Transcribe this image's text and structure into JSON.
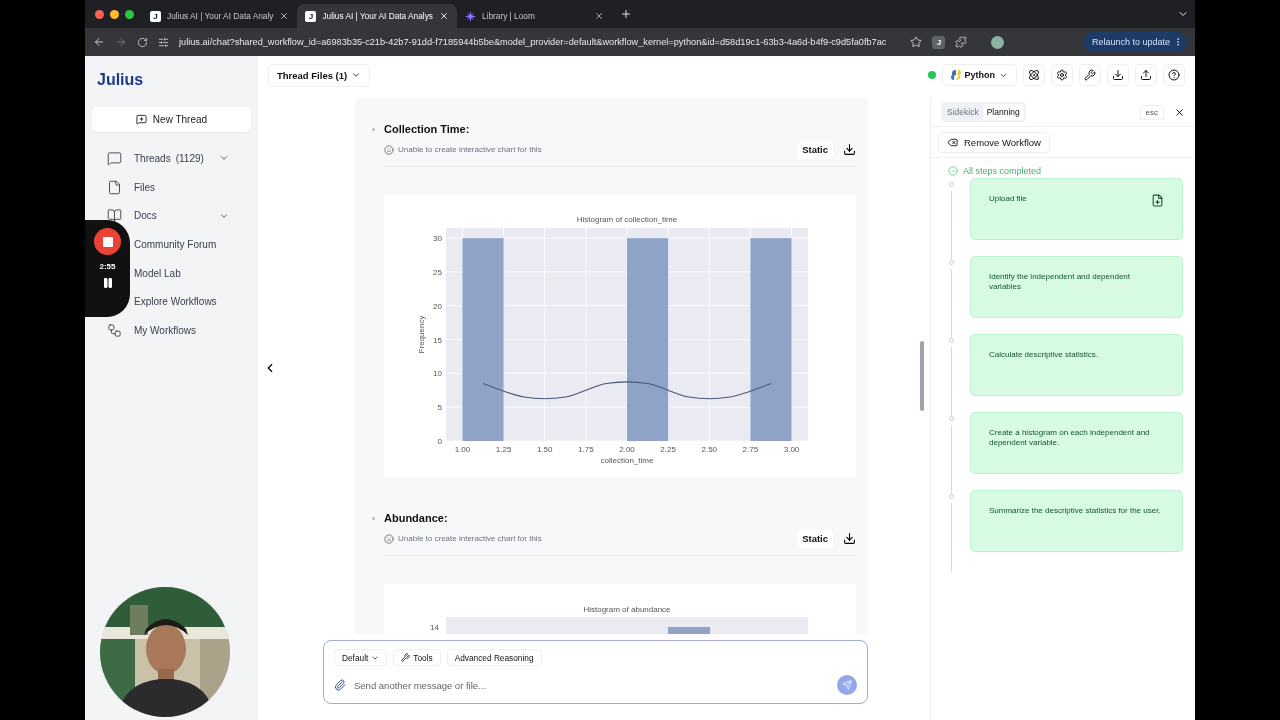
{
  "browser": {
    "tabs": [
      {
        "title": "Julius AI | Your AI Data Analy",
        "favicon": "J",
        "selected": false
      },
      {
        "title": "Julius AI | Your AI Data Analys",
        "favicon": "J",
        "selected": true
      },
      {
        "title": "Library | Loom",
        "selected": false
      }
    ],
    "url": "julius.ai/chat?shared_workflow_id=a6983b35-c21b-42b7-91dd-f7185944b5be&model_provider=default&workflow_kernel=python&id=d58d19c1-63b3-4a6d-b4f9-c9d5fa0fb7ac",
    "extension": "J",
    "relaunch": "Relaunch to update"
  },
  "sidebar": {
    "logo": "Julius",
    "new_thread": "New Thread",
    "items": [
      {
        "label": "Threads",
        "count": "(1129)",
        "has_submenu": true
      },
      {
        "label": "Files",
        "has_submenu": false
      },
      {
        "label": "Docs",
        "has_submenu": true
      },
      {
        "label": "Community Forum",
        "has_submenu": false
      },
      {
        "label": "Model Lab",
        "has_submenu": false
      },
      {
        "label": "Explore Workflows",
        "has_submenu": false
      },
      {
        "label": "My Workflows",
        "has_submenu": false
      }
    ]
  },
  "recorder": {
    "time": "2:55"
  },
  "header": {
    "thread_files": "Thread Files (1)",
    "kernel": "Python",
    "kernel_connected": true
  },
  "sections": [
    {
      "title": "Collection Time:",
      "notice": "Unable to create interactive chart for this",
      "mode_button": "Static",
      "chart": {
        "kind": "histogram",
        "chart_data": {
          "type": "bar",
          "title": "Histogram of collection_time",
          "xlabel": "collection_time",
          "ylabel": "Frequency",
          "x": [
            1.125,
            1.375,
            1.625,
            1.875,
            2.125,
            2.375,
            2.625,
            2.875
          ],
          "series": [
            {
              "type": "bar",
              "color": "#8fa3c9",
              "values": [
                30,
                0,
                0,
                0,
                30,
                0,
                0,
                30
              ]
            },
            {
              "type": "line",
              "color": "#4a5675",
              "values": [
                8.5,
                6.5,
                6.5,
                8.5,
                8.5,
                6.5,
                6.5,
                8.5
              ]
            }
          ],
          "grid": true,
          "xlim": [
            0.9,
            3.1
          ],
          "ylim": [
            0,
            31.5
          ],
          "xticks": [
            {
              "value": 1,
              "label": "1.00"
            },
            {
              "value": 1.25,
              "label": "1.25"
            },
            {
              "value": 1.5,
              "label": "1.50"
            },
            {
              "value": 1.75,
              "label": "1.75"
            },
            {
              "value": 2,
              "label": "2.00"
            },
            {
              "value": 2.25,
              "label": "2.25"
            },
            {
              "value": 2.5,
              "label": "2.50"
            },
            {
              "value": 2.75,
              "label": "2.75"
            },
            {
              "value": 3,
              "label": "3.00"
            }
          ],
          "yticks": [
            0,
            5,
            10,
            15,
            20,
            25,
            30
          ]
        }
      }
    },
    {
      "title": "Abundance:",
      "notice": "Unable to create interactive chart for this",
      "mode_button": "Static",
      "chart": {
        "kind": "preview",
        "title": "Histogram of abundance",
        "tick_label": "14"
      }
    }
  ],
  "composer": {
    "model": "Default",
    "tools": "Tools",
    "reasoning": "Advanced Reasoning",
    "placeholder": "Send another message or file..."
  },
  "sidekick": {
    "tabs": [
      {
        "label": "Sidekick",
        "selected": false
      },
      {
        "label": "Planning",
        "selected": true
      }
    ],
    "esc": "esc",
    "remove_workflow": "Remove Workflow",
    "status": "All steps completed",
    "steps": [
      {
        "text": "Upload file",
        "completed": true,
        "has_file": true
      },
      {
        "text": "Identify the independent and dependent variables",
        "completed": true,
        "has_file": false
      },
      {
        "text": "Calculate descriptive statistics.",
        "completed": true,
        "has_file": false
      },
      {
        "text": "Create a histogram on each independent and dependent variable.",
        "completed": true,
        "has_file": false
      },
      {
        "text": "Summarize the descriptive statistics for the user.",
        "completed": true,
        "has_file": false
      }
    ]
  }
}
